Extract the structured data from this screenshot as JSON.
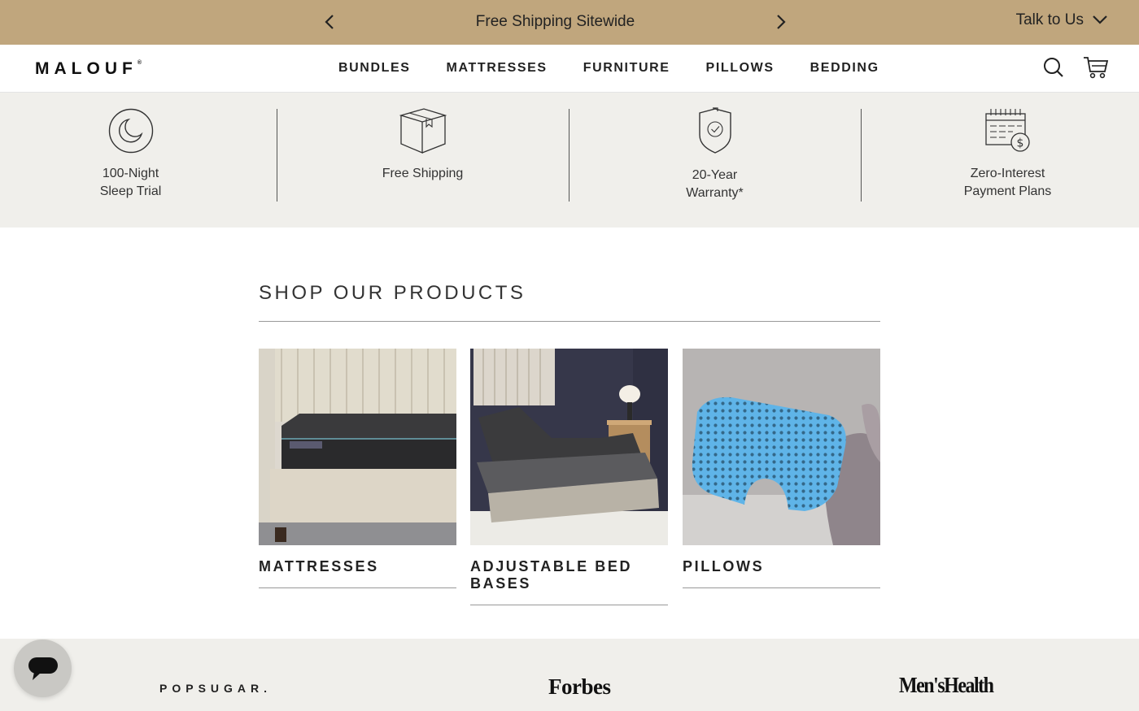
{
  "announcement": {
    "message": "Free Shipping Sitewide",
    "talk_label": "Talk to Us"
  },
  "header": {
    "logo": "MALOUF",
    "nav": [
      "BUNDLES",
      "MATTRESSES",
      "FURNITURE",
      "PILLOWS",
      "BEDDING"
    ]
  },
  "benefits": [
    {
      "line1": "100-Night",
      "line2": "Sleep Trial",
      "icon": "moon-icon"
    },
    {
      "line1": "Free Shipping",
      "line2": "",
      "icon": "box-icon"
    },
    {
      "line1": "20-Year",
      "line2": "Warranty*",
      "icon": "shield-check-icon"
    },
    {
      "line1": "Zero-Interest",
      "line2": "Payment Plans",
      "icon": "calendar-dollar-icon"
    }
  ],
  "shop": {
    "title": "SHOP OUR PRODUCTS",
    "products": [
      {
        "name": "MATTRESSES"
      },
      {
        "name": "ADJUSTABLE BED BASES"
      },
      {
        "name": "PILLOWS"
      }
    ]
  },
  "press": [
    "POPSUGAR.",
    "Forbes",
    "Men'sHealth"
  ],
  "colors": {
    "announce_bg": "#c0a67d",
    "strip_bg": "#f0efeb",
    "pillow_blue": "#5fb4e8"
  }
}
